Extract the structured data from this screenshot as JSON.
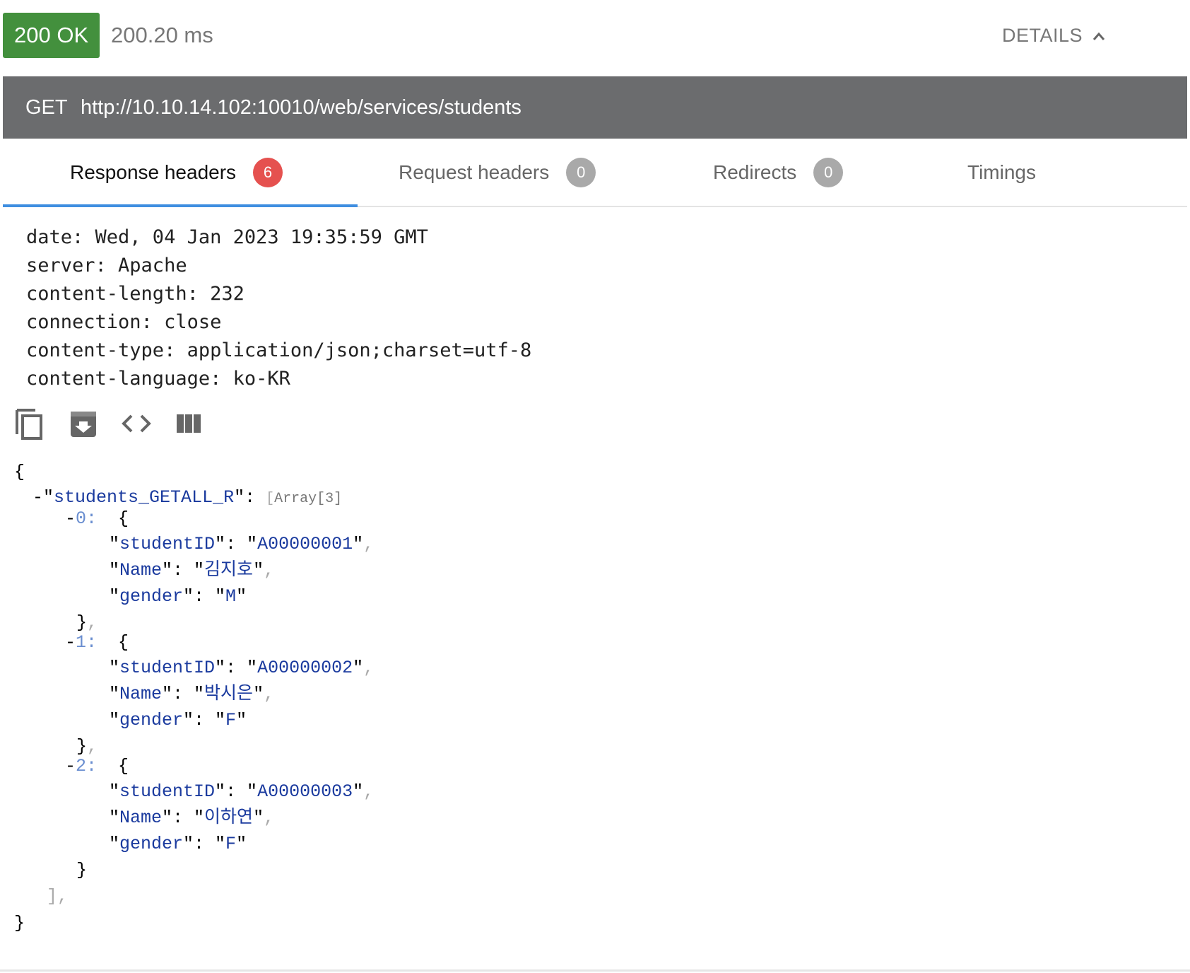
{
  "status": {
    "code_text": "200 OK",
    "elapsed": "200.20 ms",
    "details_label": "DETAILS",
    "color": "#43903d"
  },
  "request": {
    "method": "GET",
    "url": "http://10.10.14.102:10010/web/services/students"
  },
  "tabs": [
    {
      "label": "Response headers",
      "count": "6",
      "active": true
    },
    {
      "label": "Request headers",
      "count": "0",
      "active": false
    },
    {
      "label": "Redirects",
      "count": "0",
      "active": false
    },
    {
      "label": "Timings",
      "count": "",
      "active": false
    }
  ],
  "response_headers": [
    "date: Wed, 04 Jan 2023 19:35:59 GMT",
    "server: Apache",
    "content-length: 232",
    "connection: close",
    "content-type: application/json;charset=utf-8",
    "content-language: ko-KR"
  ],
  "toolbar_icons": [
    "copy-icon",
    "save-icon",
    "code-icon",
    "columns-icon"
  ],
  "body": {
    "root_key": "students_GETALL_R",
    "array_meta": "Array[3]",
    "students": [
      {
        "index": "0",
        "studentID": "A00000001",
        "Name": "김지호",
        "gender": "M"
      },
      {
        "index": "1",
        "studentID": "A00000002",
        "Name": "박시은",
        "gender": "F"
      },
      {
        "index": "2",
        "studentID": "A00000003",
        "Name": "이하연",
        "gender": "F"
      }
    ],
    "field_keys": {
      "id": "studentID",
      "name": "Name",
      "gender": "gender"
    }
  }
}
